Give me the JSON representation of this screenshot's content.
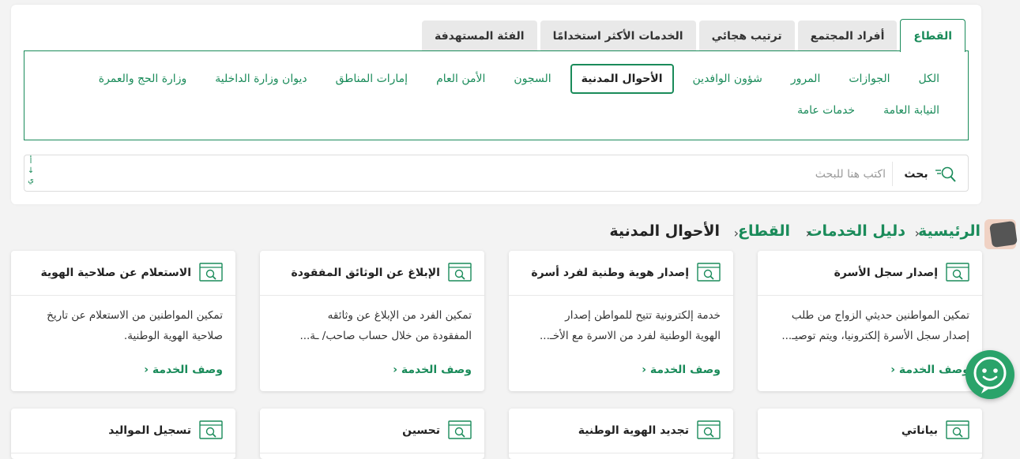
{
  "tabs": [
    {
      "label": "القطاع",
      "active": true
    },
    {
      "label": "أفراد المجتمع",
      "active": false
    },
    {
      "label": "ترتيب هجائي",
      "active": false
    },
    {
      "label": "الخدمات الأكثر استخدامًا",
      "active": false
    },
    {
      "label": "الفئة المستهدفة",
      "active": false
    }
  ],
  "sectors_row1": [
    {
      "label": "الكل",
      "active": false
    },
    {
      "label": "الجوازات",
      "active": false
    },
    {
      "label": "المرور",
      "active": false
    },
    {
      "label": "شؤون الوافدين",
      "active": false
    },
    {
      "label": "الأحوال المدنية",
      "active": true
    },
    {
      "label": "السجون",
      "active": false
    },
    {
      "label": "الأمن العام",
      "active": false
    },
    {
      "label": "إمارات المناطق",
      "active": false
    },
    {
      "label": "ديوان وزارة الداخلية",
      "active": false
    },
    {
      "label": "وزارة الحج والعمرة",
      "active": false
    }
  ],
  "sectors_row2": [
    {
      "label": "النيابة العامة",
      "active": false
    },
    {
      "label": "خدمات عامة",
      "active": false
    }
  ],
  "search": {
    "button_label": "بحث",
    "placeholder": "اكتب هنا للبحث",
    "sort_top": "أ",
    "sort_arrow": "↓",
    "sort_bottom": "ي"
  },
  "breadcrumb": {
    "home": "الرئيسية",
    "guide": "دليل الخدمات",
    "sector": "القطاع",
    "current": "الأحوال المدنية",
    "separator": "‹"
  },
  "cards": [
    {
      "title": "إصدار سجل الأسرة",
      "desc_line1": "تمكين المواطنين حديثي الزواج من طلب",
      "desc_line2": "إصدار سجل الأسرة إلكترونيا، ويتم توصيـ...",
      "link": "وصف الخدمة ‹"
    },
    {
      "title": "إصدار هوية وطنية لفرد أسرة",
      "desc_line1": "خدمة إلكترونية تتيح للمواطن إصدار",
      "desc_line2": "الهوية الوطنية لفرد من الاسرة مع الأخـ...",
      "link": "وصف الخدمة ‹"
    },
    {
      "title": "الإبلاغ عن الوثائق المفقودة",
      "desc_line1": "تمكين الفرد من الإبلاغ عن وثائقه",
      "desc_line2": "المفقودة من خلال حساب صاحب/ ـة...",
      "link": "وصف الخدمة ‹"
    },
    {
      "title": "الاستعلام عن صلاحية الهوية",
      "desc_line1": "تمكين المواطنين من الاستعلام عن تاريخ",
      "desc_line2": "صلاحية الهوية الوطنية.",
      "link": "وصف الخدمة ‹"
    },
    {
      "title": "بياناتي",
      "desc_line1": "",
      "desc_line2": "",
      "link": ""
    },
    {
      "title": "تجديد الهوية الوطنية",
      "desc_line1": "",
      "desc_line2": "",
      "link": ""
    },
    {
      "title": "تحسين",
      "desc_line1": "",
      "desc_line2": "",
      "link": ""
    },
    {
      "title": "تسجيل المواليد",
      "desc_line1": "",
      "desc_line2": "",
      "link": ""
    }
  ],
  "colors": {
    "accent": "#1a8b5a",
    "chat": "#2aa36a"
  }
}
